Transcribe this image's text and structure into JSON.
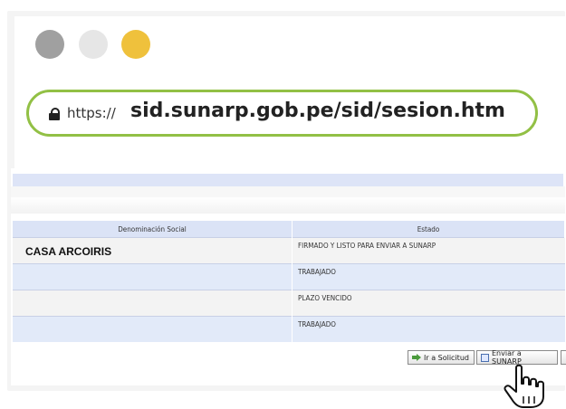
{
  "browser": {
    "url_protocol": "https://",
    "url_host_path": "sid.sunarp.gob.pe/sid/sesion.htm"
  },
  "table": {
    "headers": [
      "Denominación Social",
      "Estado"
    ],
    "rows": [
      {
        "name": "CASA ARCOIRIS",
        "state": "FIRMADO Y LISTO PARA ENVIAR A SUNARP"
      },
      {
        "name": "",
        "state": "TRABAJADO"
      },
      {
        "name": "",
        "state": "PLAZO VENCIDO"
      },
      {
        "name": "",
        "state": "TRABAJADO"
      }
    ]
  },
  "buttons": {
    "go_request": "Ir a Solicitud",
    "send_sunarp": "Enviar a SUNARP"
  },
  "icons": {
    "lock": "lock-icon",
    "cursor": "hand-pointer-icon"
  },
  "colors": {
    "url_border": "#92c045",
    "dot_gray": "#a0a0a0",
    "dot_light": "#e6e6e6",
    "dot_yellow": "#efc13c",
    "table_header": "#dbe3f6",
    "row_alt": "#e2eaf9"
  }
}
